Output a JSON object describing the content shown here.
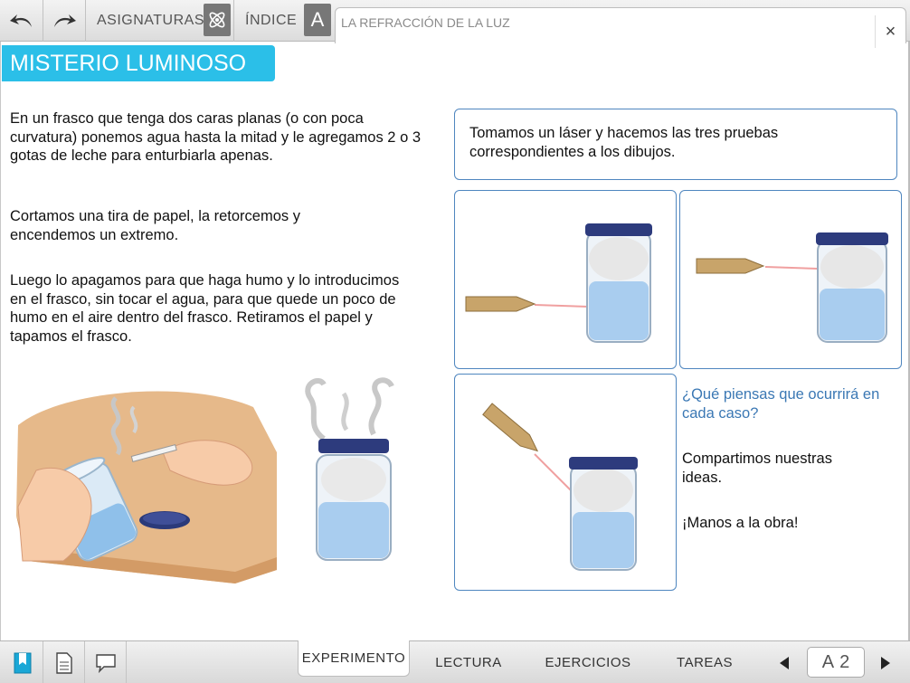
{
  "topbar": {
    "subjects_label": "ASIGNATURAS",
    "index_label": "ÍNDICE",
    "index_badge": "A",
    "tab_title": "LA REFRACCIÓN DE LA LUZ",
    "close_symbol": "×"
  },
  "page": {
    "title": "MISTERIO LUMINOSO",
    "paragraphs": [
      "En un frasco que tenga dos caras planas (o con poca curvatura) ponemos agua hasta la mitad y le agregamos 2 o 3 gotas de leche para enturbiarla apenas.",
      "Cortamos una tira de papel, la retorcemos y encendemos un extremo.",
      "Luego lo apagamos para que haga humo y lo introducimos en el frasco, sin tocar el agua, para que quede un poco de humo en el aire dentro del frasco. Retiramos el papel y tapamos el frasco."
    ],
    "intro": "Tomamos un láser y hacemos las tres pruebas correspondientes a los dibujos.",
    "question": "¿Qué piensas que ocurrirá en cada caso?",
    "share": "Compartimos nuestras ideas.",
    "hands_on": "¡Manos a la obra!"
  },
  "bottombar": {
    "tabs": [
      "EXPERIMENTO",
      "LECTURA",
      "EJERCICIOS",
      "TAREAS"
    ],
    "active_tab": "EXPERIMENTO",
    "page_letter": "A",
    "page_number": "2"
  },
  "colors": {
    "accent": "#2bbfe8",
    "box_border": "#4f86bf",
    "question_text": "#3b78b4"
  },
  "icons": [
    "undo-icon",
    "redo-icon",
    "atom-icon",
    "bookmark-icon",
    "document-icon",
    "comment-icon",
    "prev-arrow-icon",
    "next-arrow-icon",
    "close-icon"
  ]
}
